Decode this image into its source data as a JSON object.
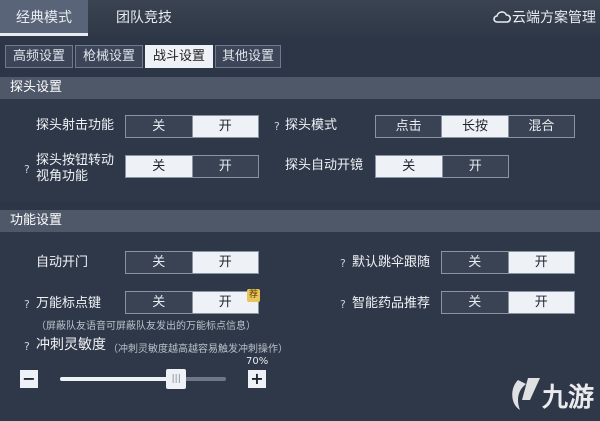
{
  "top_tabs": {
    "classic": "经典模式",
    "team": "团队竞技"
  },
  "cloud": {
    "icon": "cloud-icon",
    "label": "云端方案管理"
  },
  "sub_tabs": {
    "hf": "高频设置",
    "gun": "枪械设置",
    "combat": "战斗设置",
    "other": "其他设置"
  },
  "peek": {
    "title": "探头设置",
    "shoot": {
      "label": "探头射击功能",
      "off": "关",
      "on": "开",
      "selected": "开"
    },
    "mode": {
      "help": "?",
      "label": "探头模式",
      "opt_click": "点击",
      "opt_hold": "长按",
      "opt_mix": "混合",
      "selected": "长按"
    },
    "rotate": {
      "help": "?",
      "label1": "探头按钮转动",
      "label2": "视角功能",
      "off": "关",
      "on": "开",
      "selected": "关"
    },
    "scope": {
      "label": "探头自动开镜",
      "off": "关",
      "on": "开",
      "selected": "关"
    }
  },
  "func": {
    "title": "功能设置",
    "autodoor": {
      "label": "自动开门",
      "off": "关",
      "on": "开",
      "selected": "开"
    },
    "parachute": {
      "help": "?",
      "label": "默认跳伞跟随",
      "off": "关",
      "on": "开",
      "selected": "开"
    },
    "marker": {
      "help": "?",
      "label": "万能标点键",
      "off": "关",
      "on": "开",
      "selected": "开",
      "badge": "荐",
      "note": "（屏蔽队友语音可屏蔽队友发出的万能标点信息）"
    },
    "medkit": {
      "help": "?",
      "label": "智能药品推荐",
      "off": "关",
      "on": "开",
      "selected": "开"
    },
    "sprint": {
      "help": "?",
      "label": "冲刺灵敏度",
      "note": "（冲刺灵敏度越高越容易触发冲刺操作）",
      "value_text": "70%",
      "value": 70,
      "minus": "−",
      "plus": "+"
    }
  },
  "colors": {
    "bg": "#2d3646",
    "section": "#4e5869",
    "selected": "#eef1f6",
    "badge": "#e9c45a"
  }
}
